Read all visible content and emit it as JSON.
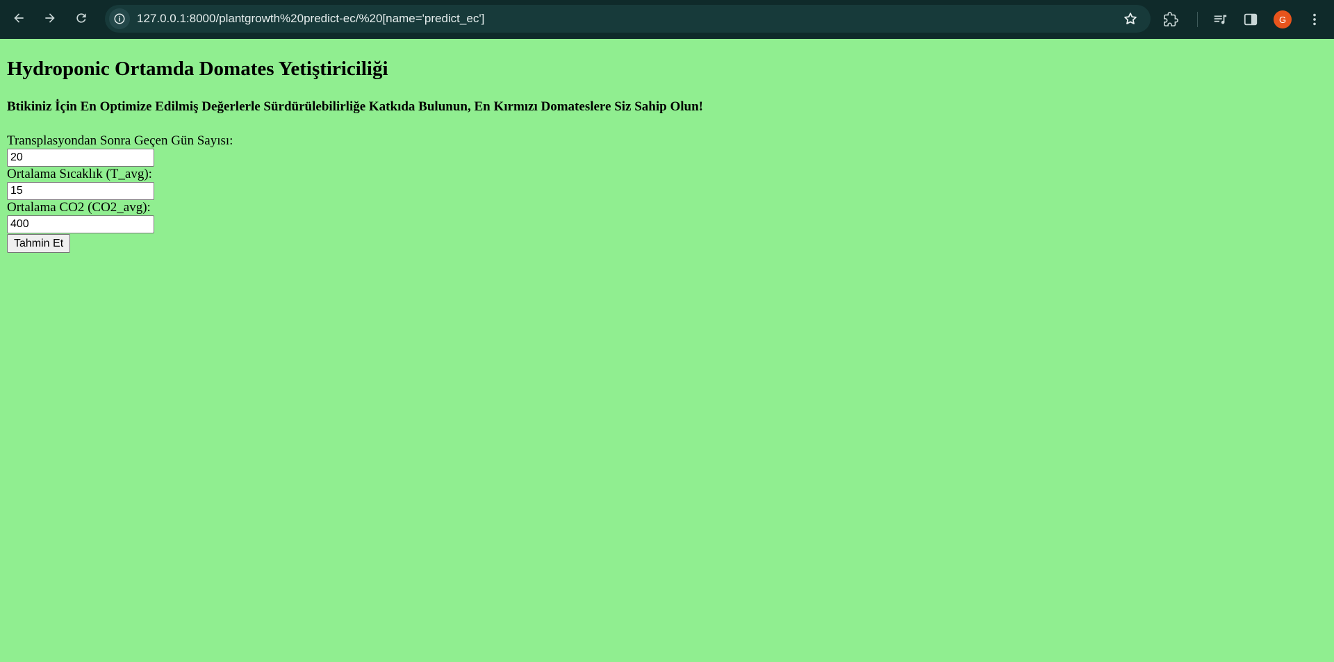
{
  "browser": {
    "url": "127.0.0.1:8000/plantgrowth%20predict-ec/%20[name='predict_ec']",
    "avatar_initial": "G",
    "icons": [
      "back-icon",
      "forward-icon",
      "reload-icon",
      "site-info-icon",
      "bookmark-star-icon",
      "extensions-icon",
      "media-controls-icon",
      "side-panel-icon",
      "more-menu-icon"
    ],
    "colors": {
      "frame": "#0f2a2a",
      "omnibox": "#173a3a",
      "avatar": "#e8541c"
    }
  },
  "page": {
    "background": "#90ee90",
    "title": "Hydroponic Ortamda Domates Yetiştiriciliği",
    "subtitle": "Btikiniz İçin En Optimize Edilmiş Değerlerle Sürdürülebilirliğe Katkıda Bulunun, En Kırmızı Domateslere Siz Sahip Olun!",
    "form": {
      "days_label": "Transplasyondan Sonra Geçen Gün Sayısı:",
      "days_value": "20",
      "temp_label": "Ortalama Sıcaklık (T_avg):",
      "temp_value": "15",
      "co2_label": "Ortalama CO2 (CO2_avg):",
      "co2_value": "400",
      "submit_label": "Tahmin Et"
    }
  }
}
